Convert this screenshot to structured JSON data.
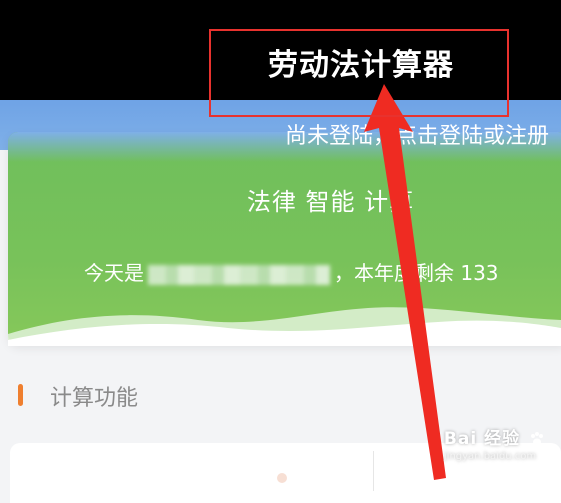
{
  "header": {
    "app_title": "劳动法计算器"
  },
  "account": {
    "login_prompt": "尚未登陆，点击登陆或注册"
  },
  "hero": {
    "slogan": "法律 智能 计算",
    "date_prefix": "今天是",
    "date_suffix": "，本年度剩余 133"
  },
  "section": {
    "title": "计算功能"
  },
  "watermark": {
    "brand": "Bai  经验",
    "url": "jingyan.baidu.com"
  },
  "colors": {
    "highlight": "#e8322e",
    "hero_green": "#78c25a",
    "accent_orange": "#ef7f2f",
    "band_blue": "#7fb0e8"
  }
}
